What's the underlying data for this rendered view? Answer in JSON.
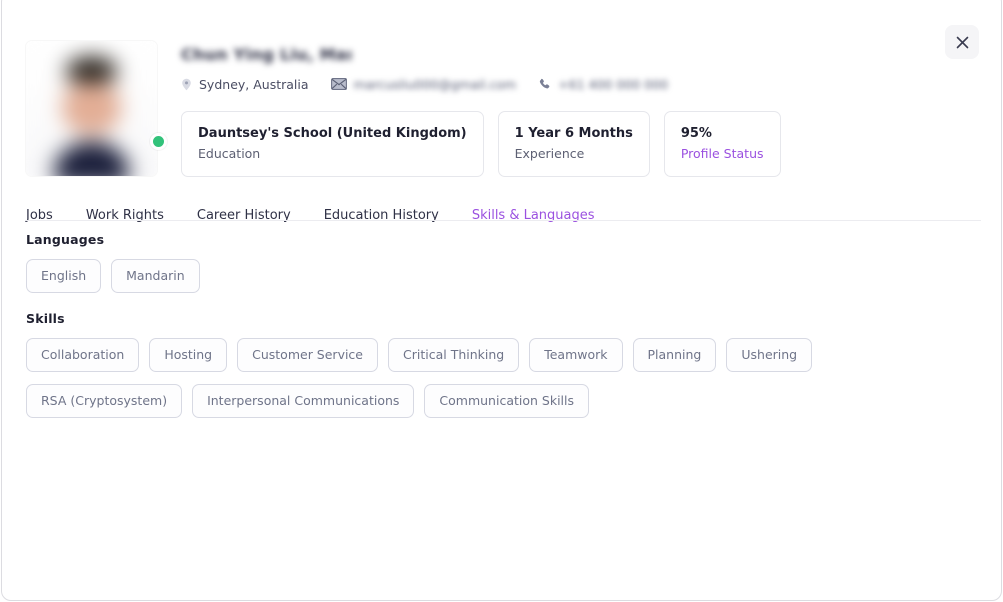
{
  "modal": {
    "close_label": "×",
    "close_icon": "close-icon"
  },
  "profile": {
    "name": "Chun Ying Liu, Marcus",
    "name_redacted": true,
    "avatar_alt": "candidate-portrait",
    "online_status": "online",
    "online_color": "#32c27a",
    "meta": [
      {
        "icon": "location-pin-icon",
        "text": "Sydney, Australia",
        "redacted": false
      },
      {
        "icon": "envelope-icon",
        "text": "marcusliu000@gmail.com",
        "redacted": true
      },
      {
        "icon": "phone-icon",
        "text": "+61 400 000 000",
        "redacted": true
      }
    ],
    "stats": [
      {
        "value": "Dauntsey's School (United Kingdom)",
        "label": "Education",
        "accent": false
      },
      {
        "value": "1 Year 6 Months",
        "label": "Experience",
        "accent": false
      },
      {
        "value": "95%",
        "label": "Profile Status",
        "accent": true
      }
    ]
  },
  "tabs": [
    {
      "label": "Jobs",
      "active": false
    },
    {
      "label": "Work Rights",
      "active": false
    },
    {
      "label": "Career History",
      "active": false
    },
    {
      "label": "Education History",
      "active": false
    },
    {
      "label": "Skills & Languages",
      "active": true
    }
  ],
  "languages": {
    "title": "Languages",
    "items": [
      "English",
      "Mandarin"
    ]
  },
  "skills": {
    "title": "Skills",
    "items": [
      "Collaboration",
      "Hosting",
      "Customer Service",
      "Critical Thinking",
      "Teamwork",
      "Planning",
      "Ushering",
      "RSA (Cryptosystem)",
      "Interpersonal Communications",
      "Communication Skills"
    ]
  },
  "colors": {
    "accent": "#9b51e0",
    "text": "#2f3146",
    "muted": "#6f7489",
    "chip_border": "#d7d9e3",
    "card_border": "#e6e7ec",
    "online": "#32c27a"
  }
}
